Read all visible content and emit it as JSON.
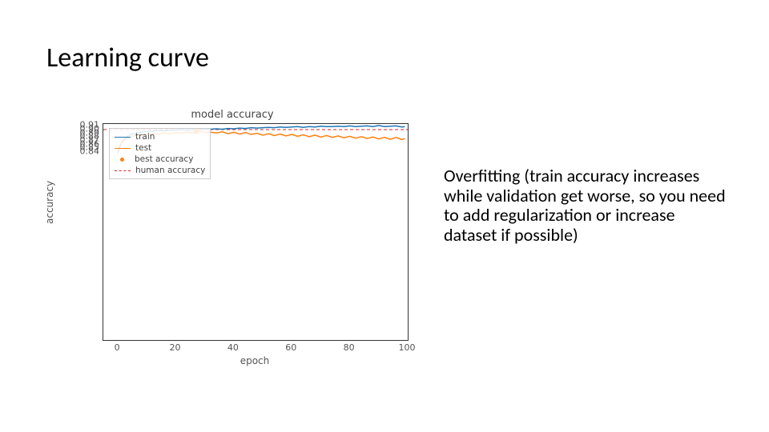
{
  "title": "Learning curve",
  "body_text": "Overfitting (train accuracy increases while validation get worse, so you need to add regularization or increase dataset if possible)",
  "chart_data": {
    "type": "line",
    "title": "model accuracy",
    "xlabel": "epoch",
    "ylabel": "accuracy",
    "xlim": [
      -5,
      100
    ],
    "ylim": [
      0.335,
      0.915
    ],
    "xticks": [
      0,
      20,
      40,
      60,
      80,
      100
    ],
    "yticks": [
      0.84,
      0.85,
      0.86,
      0.87,
      0.88,
      0.89,
      0.9,
      0.91
    ],
    "human_accuracy": 0.9,
    "best_point": {
      "x": 27,
      "y": 0.8965
    },
    "legend": {
      "train": "train",
      "test": "test",
      "best": "best accuracy",
      "human": "human accuracy"
    },
    "colors": {
      "train": "#1f77b4",
      "test": "#ff7f0e",
      "best": "#ff7f0e",
      "human": "#d62728"
    },
    "series": [
      {
        "name": "train",
        "x": [
          0,
          1,
          2,
          3,
          4,
          5,
          6,
          7,
          8,
          9,
          10,
          12,
          14,
          16,
          18,
          20,
          22,
          24,
          26,
          28,
          30,
          32,
          34,
          36,
          38,
          40,
          42,
          44,
          46,
          48,
          50,
          52,
          54,
          56,
          58,
          60,
          62,
          64,
          66,
          68,
          70,
          72,
          74,
          76,
          78,
          80,
          82,
          84,
          86,
          88,
          90,
          92,
          94,
          96,
          98,
          99
        ],
        "y": [
          0.837,
          0.86,
          0.873,
          0.88,
          0.885,
          0.888,
          0.89,
          0.892,
          0.893,
          0.894,
          0.895,
          0.896,
          0.898,
          0.897,
          0.898,
          0.899,
          0.9,
          0.899,
          0.9,
          0.901,
          0.9,
          0.901,
          0.902,
          0.901,
          0.903,
          0.902,
          0.904,
          0.903,
          0.905,
          0.904,
          0.905,
          0.906,
          0.905,
          0.907,
          0.906,
          0.907,
          0.908,
          0.906,
          0.908,
          0.907,
          0.909,
          0.908,
          0.908,
          0.909,
          0.908,
          0.91,
          0.908,
          0.909,
          0.91,
          0.908,
          0.911,
          0.908,
          0.909,
          0.91,
          0.907,
          0.908
        ]
      },
      {
        "name": "test",
        "x": [
          0,
          1,
          2,
          3,
          4,
          5,
          6,
          7,
          8,
          9,
          10,
          12,
          14,
          16,
          18,
          20,
          22,
          24,
          26,
          28,
          30,
          32,
          34,
          36,
          38,
          40,
          42,
          44,
          46,
          48,
          50,
          52,
          54,
          56,
          58,
          60,
          62,
          64,
          66,
          68,
          70,
          72,
          74,
          76,
          78,
          80,
          82,
          84,
          86,
          88,
          90,
          92,
          94,
          96,
          98,
          99
        ],
        "y": [
          0.846,
          0.862,
          0.87,
          0.876,
          0.879,
          0.882,
          0.884,
          0.886,
          0.885,
          0.888,
          0.887,
          0.889,
          0.888,
          0.891,
          0.889,
          0.892,
          0.89,
          0.894,
          0.891,
          0.896,
          0.892,
          0.893,
          0.891,
          0.894,
          0.889,
          0.893,
          0.888,
          0.892,
          0.887,
          0.89,
          0.885,
          0.889,
          0.884,
          0.888,
          0.883,
          0.887,
          0.882,
          0.886,
          0.881,
          0.885,
          0.88,
          0.884,
          0.879,
          0.883,
          0.878,
          0.882,
          0.877,
          0.881,
          0.876,
          0.88,
          0.875,
          0.879,
          0.874,
          0.879,
          0.873,
          0.876
        ]
      }
    ]
  }
}
